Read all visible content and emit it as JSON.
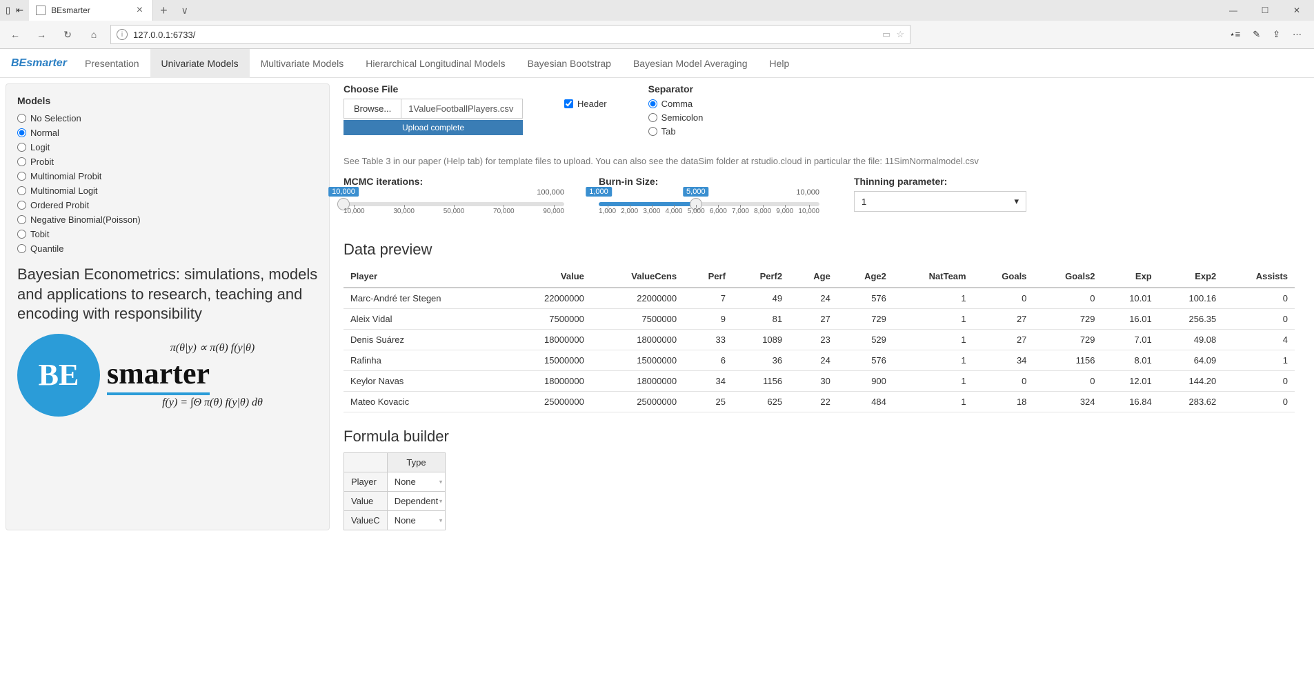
{
  "browser": {
    "tab_title": "BEsmarter",
    "url": "127.0.0.1:6733/"
  },
  "navbar": {
    "brand": "BEsmarter",
    "tabs": [
      "Presentation",
      "Univariate Models",
      "Multivariate Models",
      "Hierarchical Longitudinal Models",
      "Bayesian Bootstrap",
      "Bayesian Model Averaging",
      "Help"
    ],
    "active": "Univariate Models"
  },
  "sidebar": {
    "heading": "Models",
    "models": [
      "No Selection",
      "Normal",
      "Logit",
      "Probit",
      "Multinomial Probit",
      "Multinomial Logit",
      "Ordered Probit",
      "Negative Binomial(Poisson)",
      "Tobit",
      "Quantile"
    ],
    "selected": "Normal",
    "tagline": "Bayesian Econometrics: simulations, models and applications to research, teaching and encoding with responsibility",
    "logo_initials": "BE",
    "logo_word": "smarter",
    "eq1": "π(θ|y) ∝ π(θ) f(y|θ)",
    "eq2": "f(y) = ∫Θ π(θ) f(y|θ) dθ"
  },
  "file": {
    "label": "Choose File",
    "browse": "Browse...",
    "name": "1ValueFootballPlayers.csv",
    "status": "Upload complete"
  },
  "header_cb": {
    "label": "Header",
    "checked": true
  },
  "separator": {
    "label": "Separator",
    "options": [
      "Comma",
      "Semicolon",
      "Tab"
    ],
    "selected": "Comma"
  },
  "hint": "See Table 3 in our paper (Help tab) for template files to upload. You can also see the dataSim folder at rstudio.cloud in particular the file: 11SimNormalmodel.csv",
  "mcmc": {
    "label": "MCMC iterations:",
    "value": "10,000",
    "max": "100,000",
    "ticks": [
      "10,000",
      "30,000",
      "50,000",
      "70,000",
      "90,000"
    ]
  },
  "burnin": {
    "label": "Burn-in Size:",
    "min": "1,000",
    "value": "5,000",
    "max": "10,000",
    "ticks": [
      "1,000",
      "2,000",
      "3,000",
      "4,000",
      "5,000",
      "6,000",
      "7,000",
      "8,000",
      "9,000",
      "10,000"
    ]
  },
  "thinning": {
    "label": "Thinning parameter:",
    "value": "1"
  },
  "preview": {
    "title": "Data preview",
    "columns": [
      "Player",
      "Value",
      "ValueCens",
      "Perf",
      "Perf2",
      "Age",
      "Age2",
      "NatTeam",
      "Goals",
      "Goals2",
      "Exp",
      "Exp2",
      "Assists"
    ],
    "rows": [
      [
        "Marc-André ter Stegen",
        "22000000",
        "22000000",
        "7",
        "49",
        "24",
        "576",
        "1",
        "0",
        "0",
        "10.01",
        "100.16",
        "0"
      ],
      [
        "Aleix Vidal",
        "7500000",
        "7500000",
        "9",
        "81",
        "27",
        "729",
        "1",
        "27",
        "729",
        "16.01",
        "256.35",
        "0"
      ],
      [
        "Denis Suárez",
        "18000000",
        "18000000",
        "33",
        "1089",
        "23",
        "529",
        "1",
        "27",
        "729",
        "7.01",
        "49.08",
        "4"
      ],
      [
        "Rafinha",
        "15000000",
        "15000000",
        "6",
        "36",
        "24",
        "576",
        "1",
        "34",
        "1156",
        "8.01",
        "64.09",
        "1"
      ],
      [
        "Keylor Navas",
        "18000000",
        "18000000",
        "34",
        "1156",
        "30",
        "900",
        "1",
        "0",
        "0",
        "12.01",
        "144.20",
        "0"
      ],
      [
        "Mateo Kovacic",
        "25000000",
        "25000000",
        "25",
        "625",
        "22",
        "484",
        "1",
        "18",
        "324",
        "16.84",
        "283.62",
        "0"
      ]
    ]
  },
  "formula": {
    "title": "Formula builder",
    "header": "Type",
    "rows": [
      {
        "name": "Player",
        "type": "None"
      },
      {
        "name": "Value",
        "type": "Dependent"
      },
      {
        "name": "ValueC",
        "type": "None"
      }
    ]
  }
}
